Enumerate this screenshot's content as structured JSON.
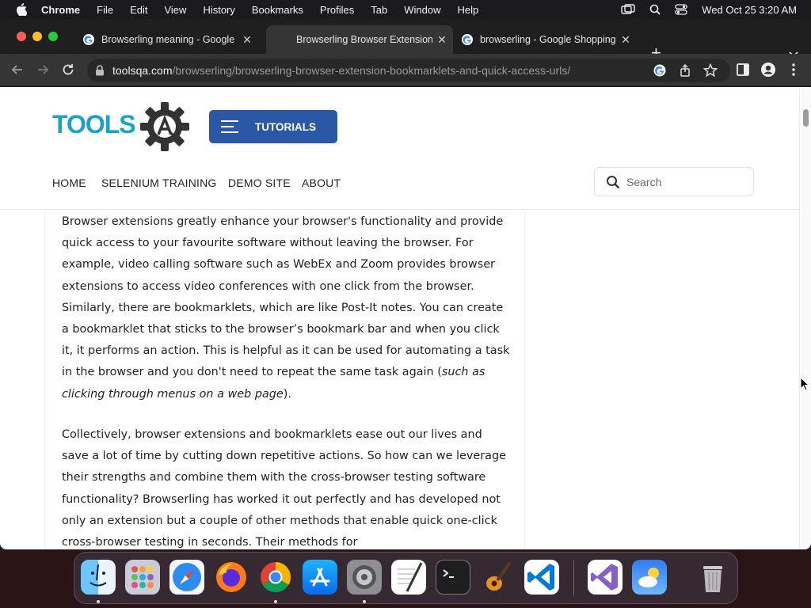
{
  "menubar": {
    "app": "Chrome",
    "items": [
      "File",
      "Edit",
      "View",
      "History",
      "Bookmarks",
      "Profiles",
      "Tab",
      "Window",
      "Help"
    ],
    "clock": "Wed Oct 25  3:20 AM"
  },
  "tabs": [
    {
      "title": "Browserling meaning - Google",
      "active": false
    },
    {
      "title": "Browserling Browser Extension",
      "active": true
    },
    {
      "title": "browserling - Google Shopping",
      "active": false
    }
  ],
  "address": {
    "host": "toolsqa.com",
    "path": "/browserling/browserling-browser-extension-bookmarklets-and-quick-access-urls/"
  },
  "site": {
    "logo_text": "TOOLS",
    "tutorials_label": "TUTORIALS",
    "nav": [
      "HOME",
      "SELENIUM TRAINING",
      "DEMO SITE",
      "ABOUT"
    ],
    "search_placeholder": "Search"
  },
  "article": {
    "p1_main": "Browser extensions greatly enhance your browser's functionality and provide quick access to your favourite software without leaving the browser. For example, video calling software such as WebEx and Zoom provides browser extensions to access video conferences with one click from the browser. Similarly, there are bookmarklets, which are like Post-It notes. You can create a bookmarklet that sticks to the browser’s bookmark bar and when you click it, it performs an action. This is helpful as it can be used for automating a task in the browser and you don't need to repeat the same task again (",
    "p1_italic": "such as clicking through menus on a web page",
    "p1_end": ").",
    "p2": "Collectively, browser extensions and bookmarklets ease out our lives and save a lot of time by cutting down repetitive actions. So how can we leverage their strengths and combine them with the cross-browser testing software functionality? Browserling has worked it out perfectly and has developed not only an extension but a couple of other methods that enable quick one-click cross-browser testing in seconds. Their methods for"
  },
  "dock": [
    "finder-icon",
    "launchpad-icon",
    "safari-icon",
    "firefox-icon",
    "chrome-icon",
    "app-store-icon",
    "system-settings-icon",
    "textedit-icon",
    "terminal-icon",
    "garageband-icon",
    "vscode-icon",
    "visual-studio-icon",
    "weather-icon",
    "trash-icon"
  ],
  "colors": {
    "brand_blue": "#2b58a6",
    "logo_teal": "#1ea0cc"
  }
}
